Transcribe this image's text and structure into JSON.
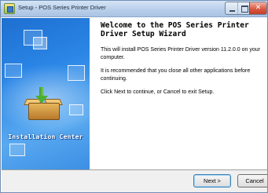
{
  "window": {
    "title": "Setup - POS Series Printer Driver"
  },
  "banner": {
    "label": "Installation Center",
    "icon": "box-install-icon"
  },
  "content": {
    "heading": "Welcome to the POS Series Printer Driver Setup Wizard",
    "paragraphs": [
      "This will install POS Series Printer Driver version 11.2.0.0 on your computer.",
      "It is recommended that you close all other applications before continuing.",
      "Click Next to continue, or Cancel to exit Setup."
    ]
  },
  "buttons": {
    "next": "Next >",
    "cancel": "Cancel"
  },
  "colors": {
    "banner_blue": "#2a86e6",
    "close_red": "#d95a44"
  }
}
